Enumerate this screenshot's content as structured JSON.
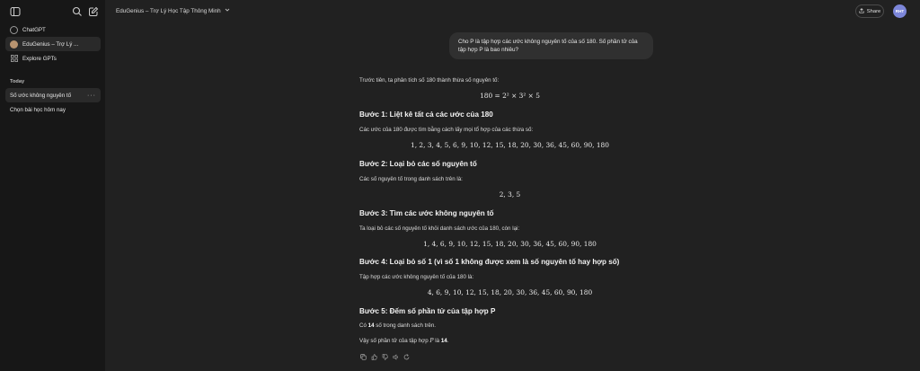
{
  "sidebar": {
    "items": [
      {
        "label": "ChatGPT",
        "icon": "chatgpt-logo-icon"
      },
      {
        "label": "EduGenius – Trợ Lý ...",
        "icon": "edugenius-avatar-icon"
      },
      {
        "label": "Explore GPTs",
        "icon": "grid-icon"
      }
    ],
    "section_title": "Today",
    "history": [
      {
        "label": "Số ước không nguyên tố"
      },
      {
        "label": "Chọn bài học hôm nay"
      }
    ]
  },
  "header": {
    "title": "EduGenius – Trợ Lý Học Tập Thông Minh",
    "share_label": "Share",
    "avatar_initials": "RHT"
  },
  "conversation": {
    "user_message": "Cho P là tập hợp các ước không nguyên tố của số 180. Số phần tử của tập hợp P là bao nhiêu?",
    "intro": "Trước tiên, ta phân tích số 180 thành thừa số nguyên tố:",
    "factorization": "180 = 2² × 3² × 5",
    "step1": {
      "heading": "Bước 1: Liệt kê tất cả các ước của 180",
      "text": "Các ước của 180 được tìm bằng cách lấy mọi tổ hợp của các thừa số:",
      "math": "1, 2, 3, 4, 5, 6, 9, 10, 12, 15, 18, 20, 30, 36, 45, 60, 90, 180"
    },
    "step2": {
      "heading": "Bước 2: Loại bỏ các số nguyên tố",
      "text": "Các số nguyên tố trong danh sách trên là:",
      "math": "2, 3, 5"
    },
    "step3": {
      "heading": "Bước 3: Tìm các ước không nguyên tố",
      "text": "Ta loại bỏ các số nguyên tố khỏi danh sách ước của 180, còn lại:",
      "math": "1, 4, 6, 9, 10, 12, 15, 18, 20, 30, 36, 45, 60, 90, 180"
    },
    "step4": {
      "heading": "Bước 4: Loại bỏ số 1 (vì số 1 không được xem là số nguyên tố hay hợp số)",
      "text": "Tập hợp các ước không nguyên tố của 180 là:",
      "math": "4, 6, 9, 10, 12, 15, 18, 20, 30, 36, 45, 60, 90, 180"
    },
    "step5": {
      "heading": "Bước 5: Đếm số phần tử của tập hợp P",
      "count_prefix": "Có ",
      "count_value": "14",
      "count_suffix": " số trong danh sách trên.",
      "conclusion_prefix": "Vậy số phần tử của tập hợp ",
      "set_name": "P",
      "conclusion_mid": " là ",
      "conclusion_value": "14",
      "conclusion_suffix": "."
    }
  },
  "actions": [
    "copy-icon",
    "thumbs-up-icon",
    "thumbs-down-icon",
    "read-aloud-icon",
    "regenerate-icon"
  ]
}
